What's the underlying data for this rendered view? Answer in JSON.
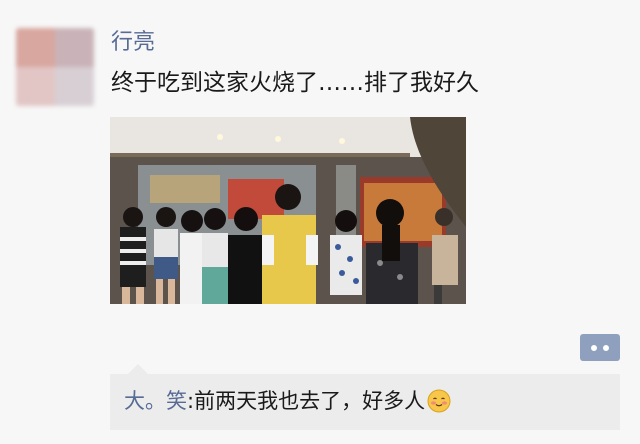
{
  "post": {
    "author": "行亮",
    "text": "终于吃到这家火烧了……排了我好久"
  },
  "comment": {
    "author": "大。笑",
    "separator": ": ",
    "text": "前两天我也去了，好多人",
    "emoji": "smiling-blush-emoji"
  },
  "icons": {
    "comment_button": "more-dots-icon"
  },
  "colors": {
    "link": "#576b95",
    "comment_bg": "#ececec",
    "comment_button": "#8fa0bf"
  }
}
